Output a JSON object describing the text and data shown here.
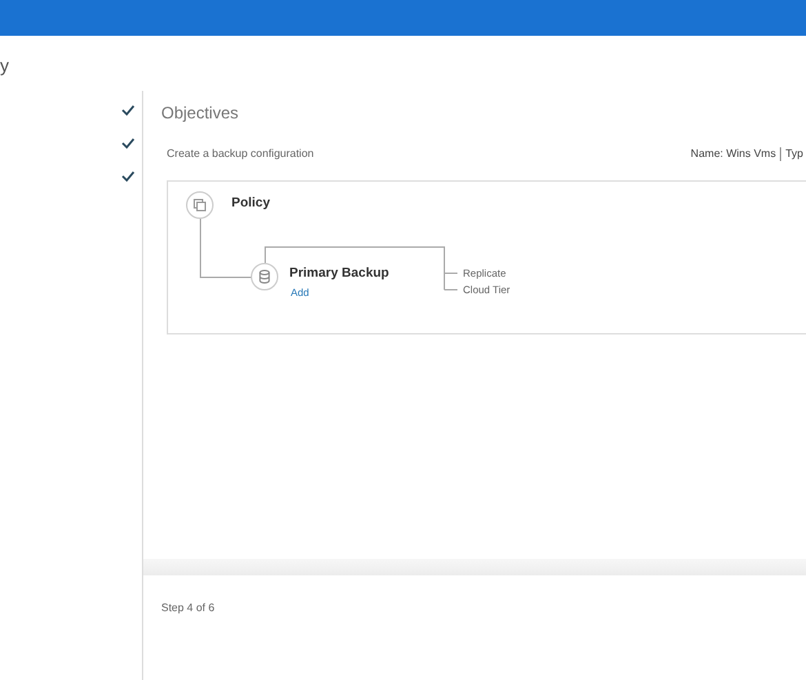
{
  "page_title": "y",
  "steps": [
    {
      "completed": true
    },
    {
      "completed": true
    },
    {
      "completed": true
    }
  ],
  "section_title": "Objectives",
  "subtitle": "Create a backup configuration",
  "meta": [
    {
      "text": "Name: Wins Vms"
    },
    {
      "text": "Typ"
    }
  ],
  "diagram": {
    "policy": {
      "label": "Policy"
    },
    "primary": {
      "label": "Primary Backup",
      "action": "Add"
    },
    "branches": [
      {
        "label": "Replicate"
      },
      {
        "label": "Cloud Tier"
      }
    ]
  },
  "footer": {
    "step_text": "Step 4 of 6"
  }
}
